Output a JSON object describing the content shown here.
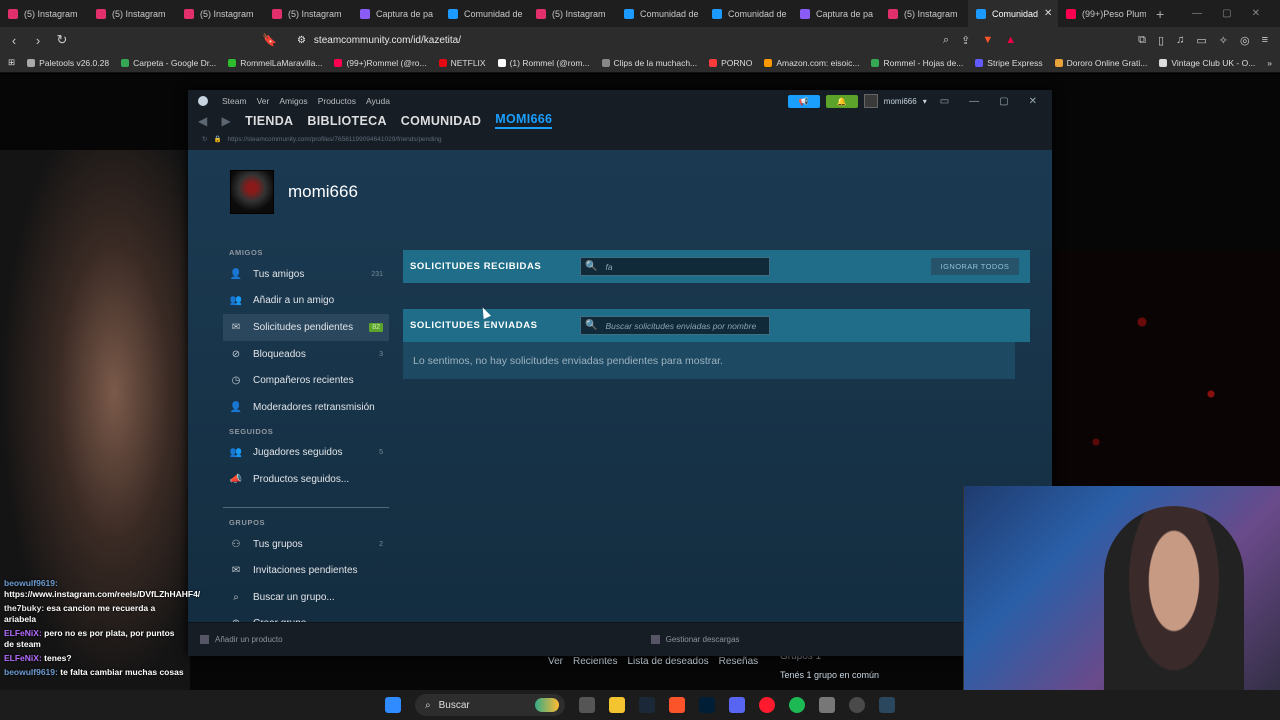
{
  "browser": {
    "tabs": [
      {
        "label": "(5) Instagram",
        "color": "#e1306c"
      },
      {
        "label": "(5) Instagram",
        "color": "#e1306c"
      },
      {
        "label": "(5) Instagram",
        "color": "#e1306c"
      },
      {
        "label": "(5) Instagram",
        "color": "#e1306c"
      },
      {
        "label": "Captura de pa",
        "color": "#8a5cf6"
      },
      {
        "label": "Comunidad de",
        "color": "#1b9aff"
      },
      {
        "label": "(5) Instagram",
        "color": "#e1306c"
      },
      {
        "label": "Comunidad de",
        "color": "#1b9aff"
      },
      {
        "label": "Comunidad de",
        "color": "#1b9aff"
      },
      {
        "label": "Captura de pa",
        "color": "#8a5cf6"
      },
      {
        "label": "(5) Instagram",
        "color": "#e1306c"
      },
      {
        "label": "Comunidad",
        "color": "#1b9aff"
      },
      {
        "label": "(99+)Peso Plum",
        "color": "#ff0050"
      }
    ],
    "url": "steamcommunity.com/id/kazetita/",
    "bookmarks": [
      {
        "label": "Paletools v26.0.28",
        "color": "#aaaaaa"
      },
      {
        "label": "Carpeta - Google Dr...",
        "color": "#34a853"
      },
      {
        "label": "RommelLaMaravilla...",
        "color": "#2dbd2d"
      },
      {
        "label": "(99+)Rommel (@ro...",
        "color": "#ff0050"
      },
      {
        "label": "NETFLIX",
        "color": "#e50914"
      },
      {
        "label": "(1) Rommel (@rom...",
        "color": "#ffffff"
      },
      {
        "label": "Clips de la muchach...",
        "color": "#888888"
      },
      {
        "label": "PORNO",
        "color": "#ff3b3b"
      },
      {
        "label": "Amazon.com: eisoic...",
        "color": "#ff9900"
      },
      {
        "label": "Rommel - Hojas de...",
        "color": "#34a853"
      },
      {
        "label": "Stripe Express",
        "color": "#635bff"
      },
      {
        "label": "Dororo Online Grati...",
        "color": "#e8a23a"
      },
      {
        "label": "Vintage Club UK - O...",
        "color": "#dddddd"
      }
    ]
  },
  "steam": {
    "menu": [
      "Steam",
      "Ver",
      "Amigos",
      "Productos",
      "Ayuda"
    ],
    "nav": [
      "TIENDA",
      "BIBLIOTECA",
      "COMUNIDAD",
      "MOMI666"
    ],
    "url": "https://steamcommunity.com/profiles/76561199094641029/friends/pending",
    "account": "momi666",
    "profile_name": "momi666",
    "sections": {
      "friends": "AMIGOS",
      "following": "SEGUIDOS",
      "groups": "GRUPOS"
    },
    "friends_items": [
      {
        "label": "Tus amigos",
        "icon": "person-icon",
        "count": "231"
      },
      {
        "label": "Añadir a un amigo",
        "icon": "add-person-icon",
        "count": ""
      },
      {
        "label": "Solicitudes pendientes",
        "icon": "envelope-icon",
        "count": "82"
      },
      {
        "label": "Bloqueados",
        "icon": "block-icon",
        "count": "3"
      },
      {
        "label": "Compañeros recientes",
        "icon": "clock-icon",
        "count": ""
      },
      {
        "label": "Moderadores retransmisión",
        "icon": "person-icon",
        "count": ""
      }
    ],
    "following_items": [
      {
        "label": "Jugadores seguidos",
        "icon": "people-icon",
        "count": "5"
      },
      {
        "label": "Productos seguidos...",
        "icon": "megaphone-icon",
        "count": ""
      }
    ],
    "group_items": [
      {
        "label": "Tus grupos",
        "icon": "group-icon",
        "count": "2"
      },
      {
        "label": "Invitaciones pendientes",
        "icon": "envelope-icon",
        "count": ""
      },
      {
        "label": "Buscar un grupo...",
        "icon": "search-icon",
        "count": ""
      },
      {
        "label": "Crear grupo...",
        "icon": "plus-icon",
        "count": ""
      }
    ],
    "received": {
      "title": "SOLICITUDES RECIBIDAS",
      "search_value": "fa",
      "ignore_label": "IGNORAR TODOS"
    },
    "sent": {
      "title": "SOLICITUDES ENVIADAS",
      "search_placeholder": "Buscar solicitudes enviadas por nombre",
      "empty_text": "Lo sentimos, no hay solicitudes enviadas pendientes para mostrar."
    },
    "footer": {
      "add_product": "Añadir un producto",
      "downloads": "Gestionar descargas"
    }
  },
  "underlying_page": {
    "links": [
      "Ver",
      "Recientes",
      "Lista de deseados",
      "Reseñas"
    ],
    "groups_label": "Grupos  1",
    "groups_line": "Tenés 1 grupo en común"
  },
  "chat": [
    {
      "user": "beowulf9619:",
      "text": "https://www.instagram.com/reels/DVfLZhHAHF4/",
      "user_color": "#6b9bd1"
    },
    {
      "user": "the7buky:",
      "text": "esa cancion me recuerda a ariabela",
      "user_color": "#e6e6e6"
    },
    {
      "user": "ELFeNiX:",
      "text": "pero no es por plata, por puntos de steam",
      "user_color": "#b36bff"
    },
    {
      "user": "ELFeNiX:",
      "text": "tenes?",
      "user_color": "#b36bff"
    },
    {
      "user": "beowulf9619:",
      "text": "te falta cambiar muchas cosas",
      "user_color": "#6b9bd1"
    }
  ],
  "taskbar": {
    "search_label": "Buscar"
  }
}
